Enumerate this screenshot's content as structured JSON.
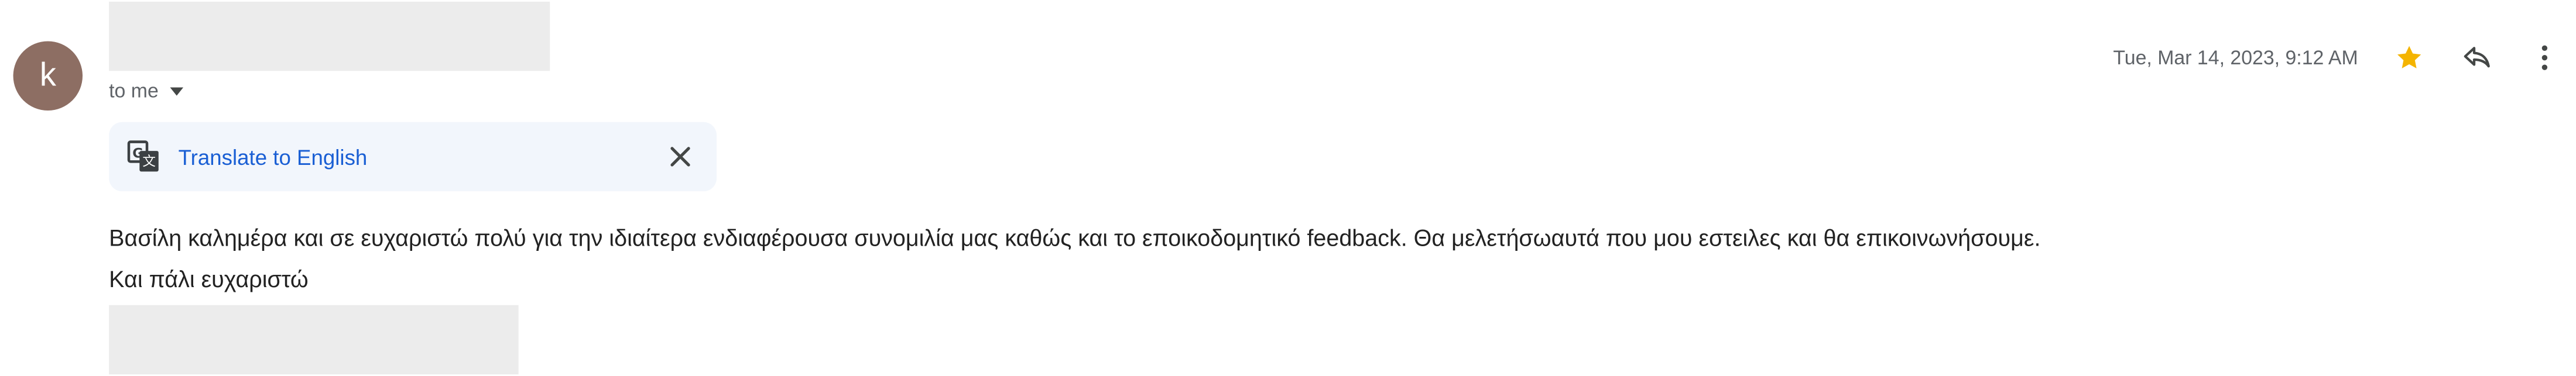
{
  "sender": {
    "avatar_letter": "k",
    "avatar_color": "#8d6e63",
    "recipients_label": "to me"
  },
  "header": {
    "date": "Tue, Mar 14, 2023, 9:12 AM",
    "starred": true,
    "star_color": "#f4b400",
    "actions": [
      "star-icon",
      "reply-icon",
      "more-vert-icon"
    ]
  },
  "translate": {
    "link_label": "Translate to English",
    "link_color": "#1a5fd4",
    "icon": "translate-icon",
    "close_icon": "close-icon"
  },
  "message": {
    "lines": [
      "Βασίλη καλημέρα και σε ευχαριστώ πολύ για την ιδιαίτερα ενδιαφέρουσα συνομιλία μας καθώς και το εποικοδομητικό feedback. Θα μελετήσωαυτά που μου εστειλες και θα επικοινωνήσουμε.",
      "Και πάλι ευχαριστώ"
    ]
  }
}
